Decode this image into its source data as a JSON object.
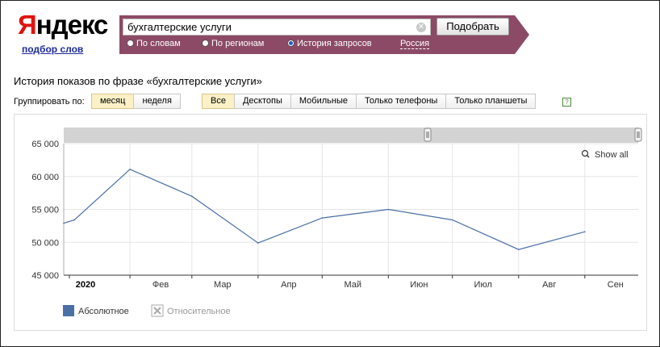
{
  "logo": {
    "first_letter": "Я",
    "rest": "ндекс",
    "subtitle": "подбор слов"
  },
  "search": {
    "query": "бухгалтерские услуги",
    "submit_label": "Подобрать",
    "modes": [
      {
        "label": "По словам",
        "selected": false
      },
      {
        "label": "По регионам",
        "selected": false
      },
      {
        "label": "История запросов",
        "selected": true
      }
    ],
    "region": "Россия"
  },
  "page_title": "История показов по фразе «бухгалтерские услуги»",
  "grouping": {
    "label": "Группировать по:",
    "options": [
      {
        "label": "месяц",
        "active": true
      },
      {
        "label": "неделя",
        "active": false
      }
    ]
  },
  "devices": [
    {
      "label": "Все",
      "active": true
    },
    {
      "label": "Десктопы",
      "active": false
    },
    {
      "label": "Мобильные",
      "active": false
    },
    {
      "label": "Только телефоны",
      "active": false
    },
    {
      "label": "Только планшеты",
      "active": false
    }
  ],
  "help_icon": "question-icon",
  "chart_data": {
    "type": "line",
    "x_year_label": "2020",
    "categories": [
      "Фев",
      "Мар",
      "Апр",
      "Май",
      "Июн",
      "Июл",
      "Авг",
      "Сен"
    ],
    "x": [
      "2020-01-01",
      "2020-01-06",
      "2020-02-01",
      "2020-03-01",
      "2020-04-01",
      "2020-05-01",
      "2020-06-01",
      "2020-07-01",
      "2020-08-01",
      "2020-09-01"
    ],
    "series": [
      {
        "name": "Абсолютное",
        "color": "#4a6fa5",
        "values": [
          52900,
          53400,
          61100,
          57000,
          49900,
          53700,
          55000,
          53400,
          48900,
          51600
        ]
      }
    ],
    "ylim": [
      45000,
      65000
    ],
    "y_ticks": [
      "45 000",
      "50 000",
      "55 000",
      "60 000",
      "65 000"
    ],
    "y_tick_values": [
      45000,
      50000,
      55000,
      60000,
      65000
    ],
    "grid": true,
    "show_all_label": "Show all",
    "legend": [
      {
        "label": "Абсолютное",
        "color": "#4a6fa5",
        "active": true
      },
      {
        "label": "Относительное",
        "color": "#aaaaaa",
        "active": false
      }
    ]
  }
}
